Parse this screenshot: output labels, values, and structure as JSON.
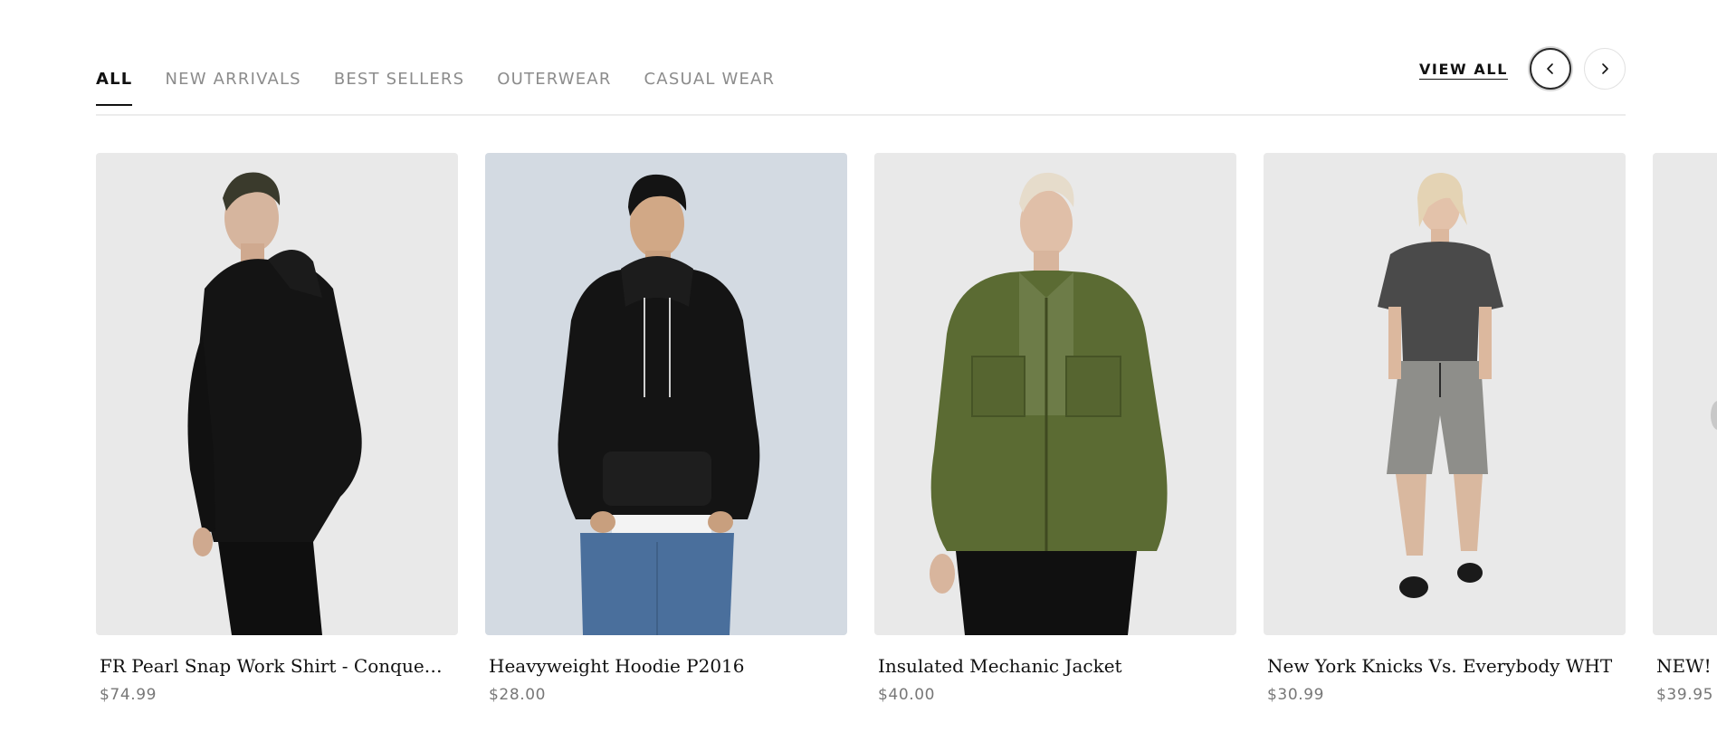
{
  "tabs": [
    {
      "label": "ALL",
      "active": true
    },
    {
      "label": "NEW ARRIVALS",
      "active": false
    },
    {
      "label": "BEST SELLERS",
      "active": false
    },
    {
      "label": "OUTERWEAR",
      "active": false
    },
    {
      "label": "CASUAL WEAR",
      "active": false
    }
  ],
  "header": {
    "view_all_label": "VIEW ALL",
    "prev_icon": "chevron-left-icon",
    "next_icon": "chevron-right-icon"
  },
  "products": [
    {
      "title": "FR Pearl Snap Work Shirt - Conquero...",
      "price": "$74.99",
      "image": "man in black hoodie and black pants"
    },
    {
      "title": "Heavyweight Hoodie P2016",
      "price": "$28.00",
      "image": "man in black hoodie and blue jeans"
    },
    {
      "title": "Insulated Mechanic Jacket",
      "price": "$40.00",
      "image": "man in olive green jacket and black pants"
    },
    {
      "title": "New York Knicks Vs. Everybody WHT",
      "price": "$30.99",
      "image": "woman in grey t-shirt and grey cargo shorts"
    },
    {
      "title": "NEW! M",
      "price": "$39.95",
      "image": "partially visible product"
    }
  ],
  "colors": {
    "text": "#111111",
    "muted": "#8c8c8c",
    "price": "#777777",
    "image_bg": "#e9e9e9",
    "image_bg_blue": "#d3dae2",
    "black_garment": "#141414",
    "denim": "#4a6f9c",
    "olive": "#5b6b33",
    "grey_shirt": "#4a4a4a",
    "grey_shorts": "#8e8e8a"
  }
}
